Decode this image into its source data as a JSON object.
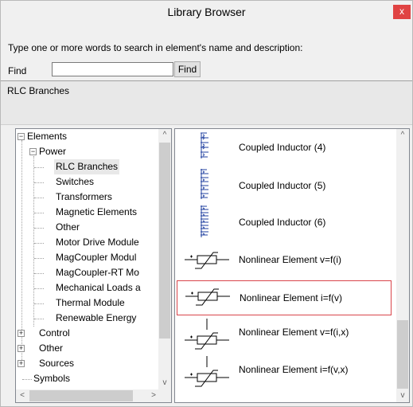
{
  "window": {
    "title": "Library Browser",
    "close_glyph": "x"
  },
  "search": {
    "instruction": "Type one or more words to search in element's name and  description:",
    "find_label": "Find",
    "find_value": "",
    "find_button": "Find"
  },
  "description": {
    "text": "RLC Branches"
  },
  "tree": {
    "items": [
      {
        "label": "Elements",
        "expander": "−"
      },
      {
        "label": "Power",
        "expander": "−"
      },
      {
        "label": "RLC Branches",
        "selected": true
      },
      {
        "label": "Switches"
      },
      {
        "label": "Transformers"
      },
      {
        "label": "Magnetic Elements"
      },
      {
        "label": "Other"
      },
      {
        "label": "Motor Drive Module"
      },
      {
        "label": "MagCoupler Modul"
      },
      {
        "label": "MagCoupler-RT Mo"
      },
      {
        "label": "Mechanical Loads a"
      },
      {
        "label": "Thermal Module"
      },
      {
        "label": "Renewable Energy"
      },
      {
        "label": "Control",
        "expander": "+"
      },
      {
        "label": "Other",
        "expander": "+"
      },
      {
        "label": "Sources",
        "expander": "+"
      },
      {
        "label": "Symbols"
      }
    ]
  },
  "list": {
    "items": [
      {
        "label": "Coupled Inductor (4)",
        "icon": "coupled-inductor-4-icon"
      },
      {
        "label": "Coupled Inductor (5)",
        "icon": "coupled-inductor-5-icon"
      },
      {
        "label": "Coupled Inductor (6)",
        "icon": "coupled-inductor-6-icon"
      },
      {
        "label": "Nonlinear Element v=f(i)",
        "icon": "nonlinear-element-icon"
      },
      {
        "label": "Nonlinear Element i=f(v)",
        "icon": "nonlinear-element-icon",
        "selected": true
      },
      {
        "label": "Nonlinear Element v=f(i,x)",
        "icon": "nonlinear-element-control-icon"
      },
      {
        "label": "Nonlinear Element i=f(v,x)",
        "icon": "nonlinear-element-control-icon"
      }
    ]
  },
  "colors": {
    "close_button": "#e04343",
    "selection_border": "#d9454b",
    "coil": "#1f3f9f"
  },
  "scroll_arrows": {
    "up": "^",
    "down": "v",
    "left": "<",
    "right": ">"
  }
}
